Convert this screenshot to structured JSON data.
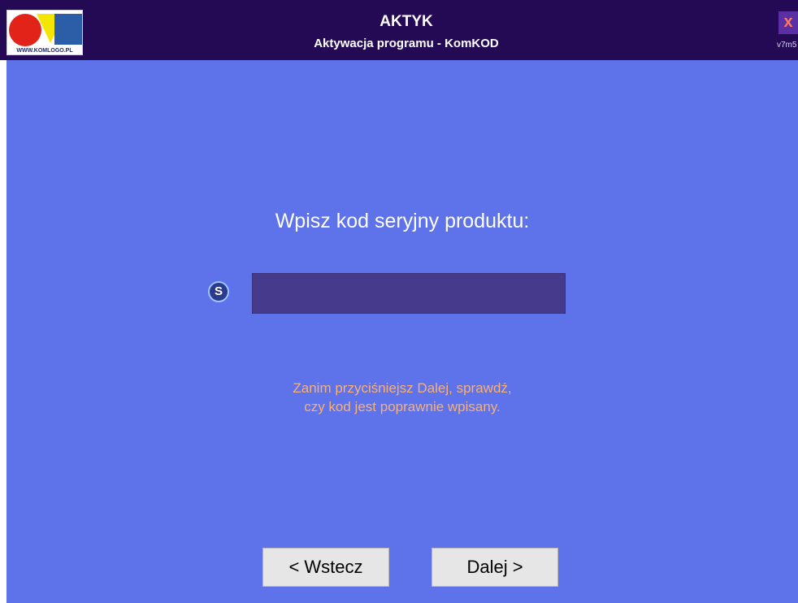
{
  "header": {
    "title": "AKTYK",
    "subtitle": "Aktywacja programu - KomKOD",
    "logo_text": "WWW.KOMLOGO.PL",
    "close_label": "x",
    "version": "v7m5"
  },
  "main": {
    "prompt": "Wpisz kod seryjny produktu:",
    "serial_icon_label": "S",
    "serial_input_value": "",
    "hint_line1": "Zanim przyciśniejsz Dalej, sprawdź,",
    "hint_line2": "czy kod jest poprawnie wpisany."
  },
  "buttons": {
    "back_label": "< Wstecz",
    "next_label": "Dalej >"
  },
  "colors": {
    "titlebar": "#240a55",
    "content_background": "#5e72ea",
    "input_background": "#463a8c",
    "hint_text": "#f6b07a",
    "close_text": "#ff7a5c"
  }
}
